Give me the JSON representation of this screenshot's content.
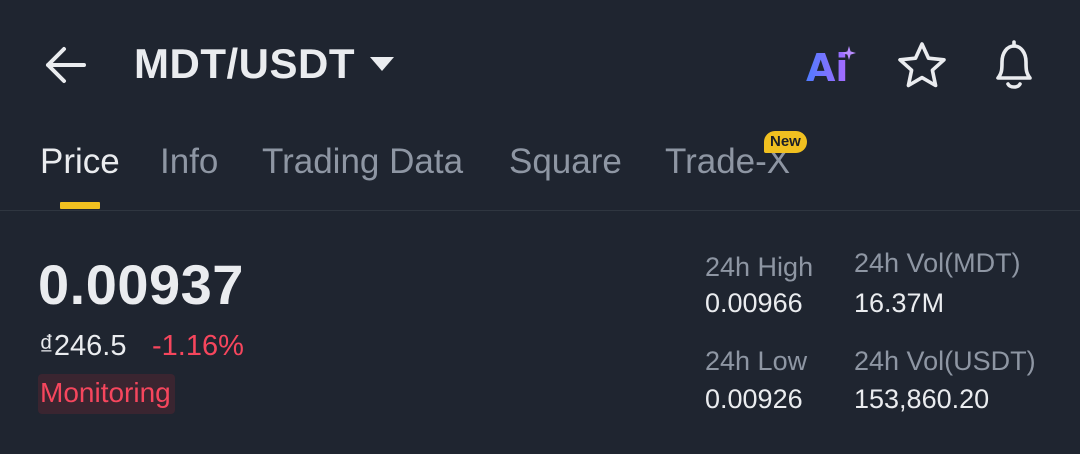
{
  "header": {
    "pair": "MDT/USDT",
    "ai_label": "Ai"
  },
  "tabs": [
    {
      "label": "Price",
      "active": true
    },
    {
      "label": "Info",
      "active": false
    },
    {
      "label": "Trading Data",
      "active": false
    },
    {
      "label": "Square",
      "active": false
    },
    {
      "label": "Trade-X",
      "active": false,
      "badge": "New"
    }
  ],
  "ticker": {
    "last_price": "0.00937",
    "fiat_price": "₫246.5",
    "change_pct": "-1.16%",
    "tag": "Monitoring"
  },
  "stats": {
    "high_label": "24h High",
    "high_value": "0.00966",
    "low_label": "24h Low",
    "low_value": "0.00926",
    "vol_base_label": "24h Vol(MDT)",
    "vol_base_value": "16.37M",
    "vol_quote_label": "24h Vol(USDT)",
    "vol_quote_value": "153,860.20"
  },
  "colors": {
    "background": "#1f2530",
    "accent": "#f0c020",
    "negative": "#f6465d",
    "muted": "#8e96a3"
  },
  "icons": [
    "arrow-left-icon",
    "caret-down-icon",
    "ai-icon",
    "star-icon",
    "bell-icon"
  ]
}
